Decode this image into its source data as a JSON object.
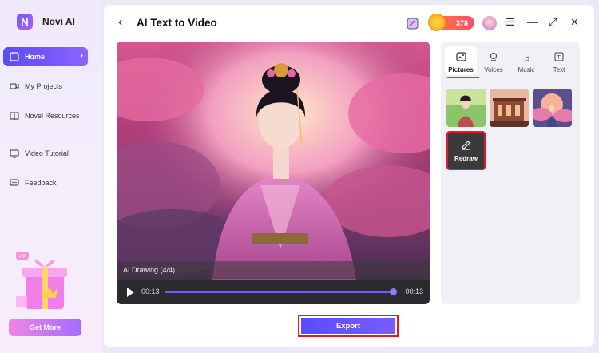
{
  "app": {
    "brand": "Novi AI"
  },
  "sidebar": {
    "items": [
      {
        "label": "Home",
        "icon": "home-icon",
        "active": true
      },
      {
        "label": "My Projects",
        "icon": "video-icon"
      },
      {
        "label": "Novel Resources",
        "icon": "book-icon"
      },
      {
        "label": "Video Tutorial",
        "icon": "tutorial-icon"
      },
      {
        "label": "Feedback",
        "icon": "feedback-icon"
      }
    ],
    "get_more": "Get More",
    "gift_badge": "VIP"
  },
  "header": {
    "title": "AI Text to Video",
    "coins": "378"
  },
  "player": {
    "label": "AI Drawing  (4/4)",
    "time_current": "00:13",
    "time_total": "00:13",
    "progress": 1.0
  },
  "panel": {
    "tabs": [
      {
        "label": "Pictures",
        "icon": "picture-icon",
        "active": true
      },
      {
        "label": "Voices",
        "icon": "voice-icon"
      },
      {
        "label": "Music",
        "icon": "music-icon"
      },
      {
        "label": "Text",
        "icon": "text-icon"
      }
    ],
    "redraw_label": "Redraw"
  },
  "export_label": "Export",
  "colors": {
    "accent": "#5a4bff",
    "highlight": "#e01a2b"
  }
}
